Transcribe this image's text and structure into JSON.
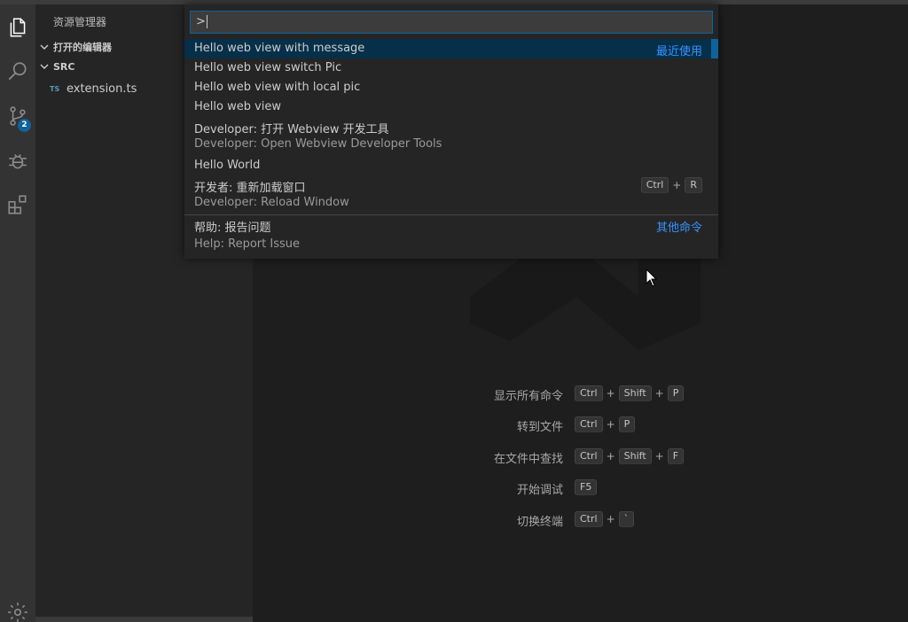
{
  "sidebar": {
    "title": "资源管理器",
    "sections": [
      {
        "label": "打开的编辑器"
      },
      {
        "label": "SRC"
      }
    ],
    "files": [
      {
        "icon_text": "TS",
        "label": "extension.ts"
      }
    ]
  },
  "activitybar": {
    "items": [
      "explorer-icon",
      "search-icon",
      "source-control-icon",
      "debug-icon",
      "extensions-icon"
    ],
    "scm_badge": "2",
    "bottom": "gear-icon"
  },
  "quick_input": {
    "value": ">",
    "items": [
      {
        "label": "Hello web view with message",
        "right": "最近使用"
      },
      {
        "label": "Hello web view switch Pic"
      },
      {
        "label": "Hello web view with local pic"
      },
      {
        "label": "Hello web view"
      },
      {
        "label": "Developer: 打开 Webview 开发工具",
        "detail": "Developer: Open Webview Developer Tools"
      },
      {
        "label": "Hello World"
      },
      {
        "label": "开发者: 重新加载窗口",
        "detail": "Developer: Reload Window",
        "keys": [
          "Ctrl",
          "+",
          "R"
        ]
      },
      {
        "label": "帮助: 报告问题",
        "detail": "Help: Report Issue",
        "right": "其他命令"
      }
    ]
  },
  "shortcuts": [
    {
      "label": "显示所有命令",
      "keys": [
        "Ctrl",
        "+",
        "Shift",
        "+",
        "P"
      ]
    },
    {
      "label": "转到文件",
      "keys": [
        "Ctrl",
        "+",
        "P"
      ]
    },
    {
      "label": "在文件中查找",
      "keys": [
        "Ctrl",
        "+",
        "Shift",
        "+",
        "F"
      ]
    },
    {
      "label": "开始调试",
      "keys": [
        "F5"
      ]
    },
    {
      "label": "切换终端",
      "keys": [
        "Ctrl",
        "+",
        "`"
      ]
    }
  ],
  "colors": {
    "accent": "#3794ff",
    "selection": "#062f4a",
    "badge": "#0e639c"
  }
}
